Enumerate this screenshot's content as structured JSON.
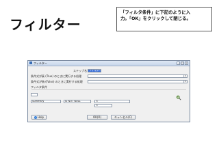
{
  "slide": {
    "title": "フィルター",
    "callout": {
      "line1": "「フィルタ条件」に下記のように入",
      "line2": "力。「OK」をクリックして閉じる。"
    }
  },
  "dialog": {
    "title": "フィルター",
    "step_label": "ステップ名",
    "step_value": "フィルター",
    "true_label": "条件式が真 (True) のときに実行する処理",
    "false_label": "条件式が偽 (False) のときに実行する処理",
    "true_value": "",
    "false_value": "",
    "filter_section_label": "フィルタ条件",
    "cond_field": "Summary",
    "cond_function": "IS NOT NULL",
    "cond_value_1": "<",
    "cond_value_2": "<",
    "buttons": {
      "help": "Help",
      "ok": "OK(O)",
      "cancel": "キャンセル(C)"
    }
  }
}
